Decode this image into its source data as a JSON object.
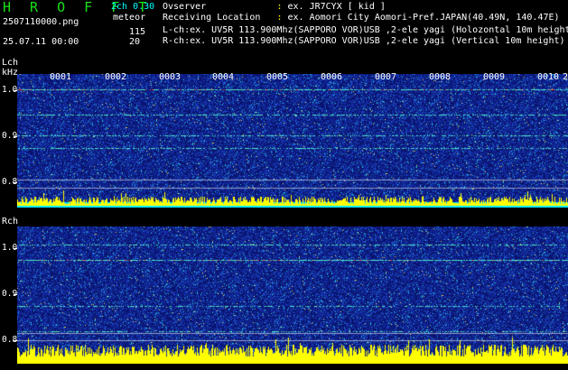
{
  "header": {
    "logo": "H R O F F T",
    "version": "2ch 0.30",
    "filename": "2507110000.png",
    "datetime": "25.07.11 00:00",
    "mode": "meteor",
    "count1": "115",
    "count2": "20",
    "observer_label": "Ovserver",
    "observer_value": "ex. JR7CYX [ kid ]",
    "location_label": "Receiving Location",
    "location_value": "ex. Aomori City Aomori-Pref.JAPAN(40.49N, 140.47E)",
    "lch_info": "L-ch:ex. UV5R 113.900Mhz(SAPPORO VOR)USB ,2-ele yagi (Holozontal 10m height)",
    "rch_info": "R-ch:ex. UV5R 113.900Mhz(SAPPORO VOR)USB ,2-ele yagi (Vertical 10m height)"
  },
  "lch": {
    "label": "Lch",
    "unit": "kHz",
    "ticks": [
      "1.0",
      "0.9",
      "0.8"
    ],
    "minutes": [
      "0001",
      "0002",
      "0003",
      "0004",
      "0005",
      "0006",
      "0007",
      "0008",
      "0009",
      "0010"
    ],
    "end_marker": "2"
  },
  "rch": {
    "label": "Rch",
    "ticks": [
      "1.0",
      "0.9",
      "0.8"
    ]
  },
  "colors": {
    "background": "#000000",
    "logo": "#19e019",
    "version": "#00ffff",
    "accent": "#ffff00",
    "noise_base": "#1a2a9a",
    "noise_bright": "#00ffff",
    "signal": "#ffff00"
  }
}
